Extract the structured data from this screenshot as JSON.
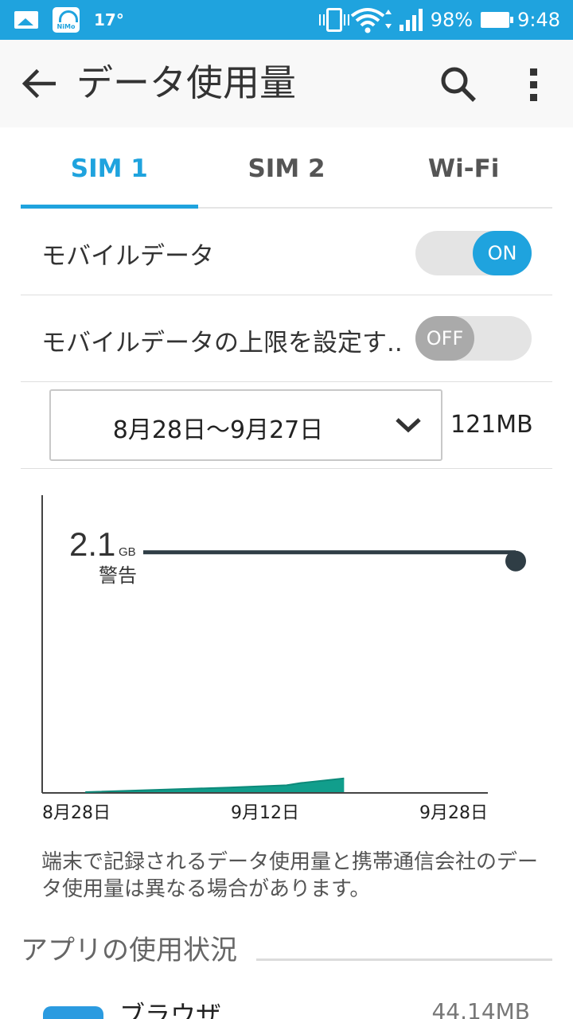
{
  "status_bar": {
    "temperature": "17°",
    "app_icon_label": "NiMo",
    "battery": "98%",
    "time": "9:48"
  },
  "header": {
    "title": "データ使用量"
  },
  "tabs": [
    {
      "label": "SIM 1",
      "active": true
    },
    {
      "label": "SIM 2",
      "active": false
    },
    {
      "label": "Wi-Fi",
      "active": false
    }
  ],
  "mobile_data": {
    "label": "モバイルデータ",
    "state": "ON"
  },
  "data_limit": {
    "label": "モバイルデータの上限を設定す..",
    "state": "OFF"
  },
  "period": {
    "range": "8月28日〜9月27日",
    "usage": "121MB"
  },
  "chart_data": {
    "type": "area",
    "x_tick_labels": [
      "8月28日",
      "9月12日",
      "9月28日"
    ],
    "warning": {
      "value": "2.1",
      "unit": "GB",
      "label": "警告"
    },
    "series": [
      {
        "color": "#119e8c",
        "x": [
          "8月31日",
          "9月5日",
          "9月10日",
          "9月14日",
          "9月15日",
          "9月18日"
        ],
        "values_gb": [
          0.0,
          0.02,
          0.04,
          0.06,
          0.08,
          0.12
        ]
      }
    ],
    "limit_line_color": "#2f3d45"
  },
  "note": "端末で記録されるデータ使用量と携帯通信会社のデータ使用量は異なる場合があります。",
  "section": {
    "title": "アプリの使用状況"
  },
  "app_rows": [
    {
      "name": "ブラウザ",
      "usage": "44.14MB"
    }
  ],
  "colors": {
    "accent": "#1fa3de",
    "status_bar": "#1fa3de"
  }
}
